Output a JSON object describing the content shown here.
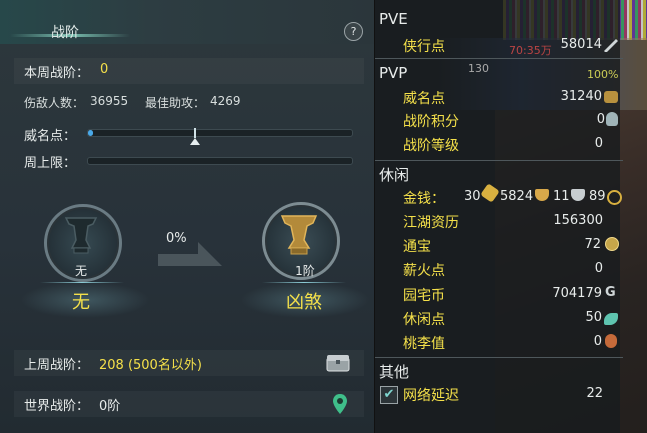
{
  "left_panel": {
    "title": "战阶",
    "help": "?",
    "weekly_rank_label": "本周战阶：",
    "weekly_rank_value": "0",
    "kills_label": "伤敌人数：",
    "kills_value": "36955",
    "assists_label": "最佳助攻：",
    "assists_value": "4269",
    "prestige_label": "威名点：",
    "prestige_progress": 0.02,
    "weekly_cap_label": "周上限：",
    "weekly_cap_progress": 0,
    "progress_percent": "0%",
    "current_medal": {
      "level": "无",
      "name": "无"
    },
    "next_medal": {
      "level": "1阶",
      "name": "凶煞"
    },
    "last_week_label": "上周战阶：",
    "last_week_value": "208 (500名以外)",
    "world_rank_label": "世界战阶：",
    "world_rank_value": "0阶"
  },
  "right_panel": {
    "bg_text": {
      "top": "70:35万",
      "mid": "130",
      "pct": "100%"
    },
    "pve": {
      "header": "PVE",
      "items": [
        {
          "label": "侠行点",
          "value": "58014"
        }
      ]
    },
    "pvp": {
      "header": "PVP",
      "items": [
        {
          "label": "威名点",
          "value": "31240"
        },
        {
          "label": "战阶积分",
          "value": "0"
        },
        {
          "label": "战阶等级",
          "value": "0"
        }
      ]
    },
    "leisure": {
      "header": "休闲",
      "money_label": "金钱：",
      "money_gold": "30",
      "money_silver": "5824",
      "money_copper": "11",
      "money_other": "89",
      "items": [
        {
          "label": "江湖资历",
          "value": "156300"
        },
        {
          "label": "通宝",
          "value": "72"
        },
        {
          "label": "薪火点",
          "value": "0"
        },
        {
          "label": "园宅币",
          "value": "704179"
        },
        {
          "label": "休闲点",
          "value": "50"
        },
        {
          "label": "桃李值",
          "value": "0"
        }
      ]
    },
    "other": {
      "header": "其他",
      "latency_label": "网络延迟",
      "latency_value": "22",
      "latency_checked": true
    }
  },
  "colors": {
    "accent_yellow": "#f4e04a",
    "bar_blue": "#4aa9e9",
    "text_light": "#e8eceb"
  }
}
